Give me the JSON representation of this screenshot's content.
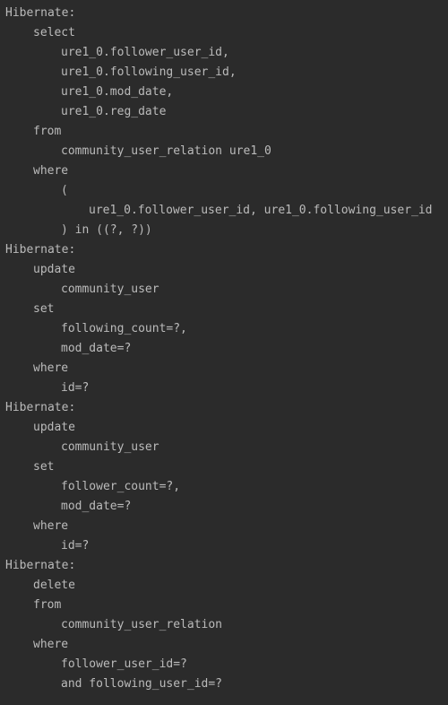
{
  "console": {
    "blocks": [
      {
        "lines": [
          {
            "indent": 0,
            "text": "Hibernate:"
          },
          {
            "indent": 1,
            "text": "select"
          },
          {
            "indent": 2,
            "text": "ure1_0.follower_user_id,"
          },
          {
            "indent": 2,
            "text": "ure1_0.following_user_id,"
          },
          {
            "indent": 2,
            "text": "ure1_0.mod_date,"
          },
          {
            "indent": 2,
            "text": "ure1_0.reg_date"
          },
          {
            "indent": 1,
            "text": "from"
          },
          {
            "indent": 2,
            "text": "community_user_relation ure1_0"
          },
          {
            "indent": 1,
            "text": "where"
          },
          {
            "indent": 2,
            "text": "("
          },
          {
            "indent": 3,
            "text": "ure1_0.follower_user_id, ure1_0.following_user_id"
          },
          {
            "indent": 2,
            "text": ") in ((?, ?))"
          }
        ]
      },
      {
        "lines": [
          {
            "indent": 0,
            "text": "Hibernate:"
          },
          {
            "indent": 1,
            "text": "update"
          },
          {
            "indent": 2,
            "text": "community_user"
          },
          {
            "indent": 1,
            "text": "set"
          },
          {
            "indent": 2,
            "text": "following_count=?,"
          },
          {
            "indent": 2,
            "text": "mod_date=?"
          },
          {
            "indent": 1,
            "text": "where"
          },
          {
            "indent": 2,
            "text": "id=?"
          }
        ]
      },
      {
        "lines": [
          {
            "indent": 0,
            "text": "Hibernate:"
          },
          {
            "indent": 1,
            "text": "update"
          },
          {
            "indent": 2,
            "text": "community_user"
          },
          {
            "indent": 1,
            "text": "set"
          },
          {
            "indent": 2,
            "text": "follower_count=?,"
          },
          {
            "indent": 2,
            "text": "mod_date=?"
          },
          {
            "indent": 1,
            "text": "where"
          },
          {
            "indent": 2,
            "text": "id=?"
          }
        ]
      },
      {
        "lines": [
          {
            "indent": 0,
            "text": "Hibernate:"
          },
          {
            "indent": 1,
            "text": "delete"
          },
          {
            "indent": 1,
            "text": "from"
          },
          {
            "indent": 2,
            "text": "community_user_relation"
          },
          {
            "indent": 1,
            "text": "where"
          },
          {
            "indent": 2,
            "text": "follower_user_id=?"
          },
          {
            "indent": 2,
            "text": "and following_user_id=?"
          }
        ]
      }
    ]
  }
}
